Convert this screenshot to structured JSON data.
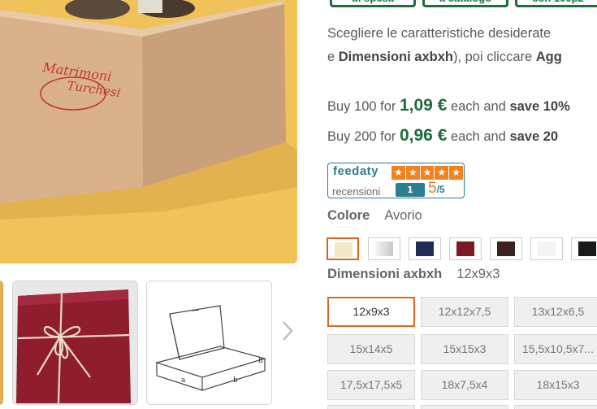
{
  "top_buttons": [
    {
      "label": "di spesa"
    },
    {
      "label": "a catalogo"
    },
    {
      "label": "con 100p2"
    }
  ],
  "instructions": {
    "line1": "Scegliere le caratteristiche desiderate",
    "line2_prefix": "e ",
    "line2_bold": "Dimensioni axbxh",
    "line2_mid": "), poi cliccare ",
    "line2_end": "Agg"
  },
  "bulk_offers": [
    {
      "prefix": "Buy 100 for ",
      "price": "1,09 €",
      "mid": " each and ",
      "save": "save 10%"
    },
    {
      "prefix": "Buy 200 for ",
      "price": "0,96 €",
      "mid": " each and ",
      "save": "save 20"
    }
  ],
  "feedaty": {
    "brand": "feedaty",
    "stars": [
      "★",
      "★",
      "★",
      "★",
      "★"
    ],
    "reviews_label": "recensioni",
    "review_count": "1",
    "score": "5",
    "score_max": "/5"
  },
  "colour": {
    "label": "Colore",
    "value": "Avorio",
    "swatches": [
      {
        "name": "avorio",
        "color": "#f2e9c8",
        "selected": true
      },
      {
        "name": "argento",
        "color": "#dcdcdc"
      },
      {
        "name": "blu",
        "color": "#1f2d56"
      },
      {
        "name": "bordeaux",
        "color": "#7b1a22"
      },
      {
        "name": "marrone",
        "color": "#3b2420"
      },
      {
        "name": "bianco",
        "color": "#f4f4f4"
      },
      {
        "name": "nero",
        "color": "#1a1a1a"
      }
    ]
  },
  "dimensions": {
    "label": "Dimensioni axbxh",
    "value": "12x9x3",
    "options": [
      [
        "12x9x3",
        "12x12x7,5",
        "13x12x6,5"
      ],
      [
        "15x14x5",
        "15x15x3",
        "15,5x10,5x7..."
      ],
      [
        "17,5x17,5x5",
        "18x7,5x4",
        "18x15x3"
      ]
    ]
  },
  "photo": {
    "box_print_line1": "Matrimoni",
    "box_print_line2": "Turchesi"
  }
}
